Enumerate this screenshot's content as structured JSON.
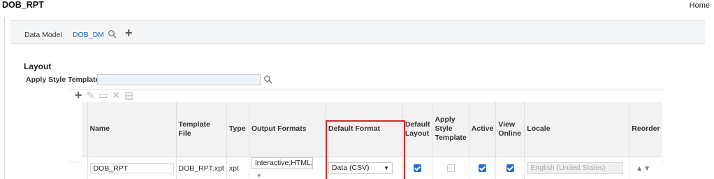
{
  "header": {
    "app_title": "DOB_RPT",
    "home_label": "Home"
  },
  "data_model": {
    "label": "Data Model",
    "name": "DOB_DM"
  },
  "layout": {
    "section_title": "Layout",
    "apply_style_label": "Apply Style Template",
    "apply_style_value": ""
  },
  "table": {
    "headers": {
      "name": "Name",
      "template_file": "Template File",
      "type": "Type",
      "output_formats": "Output Formats",
      "default_format": "Default Format",
      "default_layout": "Default Layout",
      "apply_style_template": "Apply Style Template",
      "active": "Active",
      "view_online": "View Online",
      "locale": "Locale",
      "reorder": "Reorder"
    },
    "row": {
      "name": "DOB_RPT",
      "template_file": "DOB_RPT.xpt",
      "type": "xpt",
      "output_formats": "Interactive;HTML;P",
      "default_format": "Data (CSV)",
      "default_layout": true,
      "apply_style_template": false,
      "active": true,
      "view_online": true,
      "locale": "English (United States)"
    }
  },
  "colors": {
    "link": "#1b62b3",
    "checkbox": "#1f6fd0",
    "highlight": "#cc2b2b"
  }
}
